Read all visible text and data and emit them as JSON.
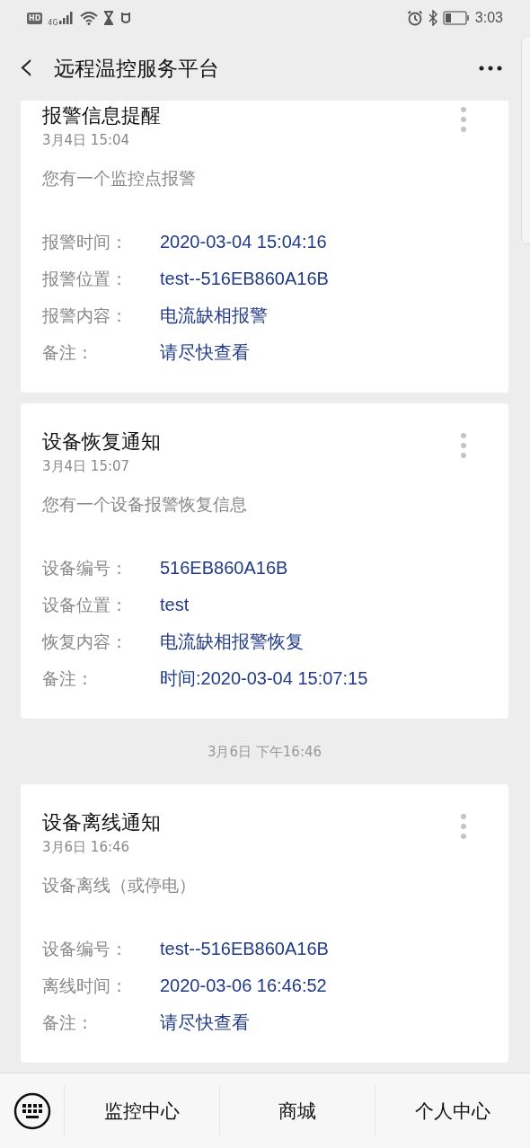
{
  "status_bar": {
    "hd_badge": "HD",
    "network": "4G",
    "time": "3:03"
  },
  "header": {
    "back": "‹",
    "title": "远程温控服务平台"
  },
  "feed": [
    {
      "kind": "card",
      "title": "报警信息提醒",
      "date": "3月4日  15:04",
      "summary": "您有一个监控点报警",
      "fields": [
        {
          "label": "报警时间：",
          "value": "2020-03-04 15:04:16"
        },
        {
          "label": "报警位置：",
          "value": "test--516EB860A16B"
        },
        {
          "label": "报警内容：",
          "value": "电流缺相报警"
        },
        {
          "label": "备注：",
          "value": "请尽快查看"
        }
      ]
    },
    {
      "kind": "card",
      "title": "设备恢复通知",
      "date": "3月4日  15:07",
      "summary": "您有一个设备报警恢复信息",
      "fields": [
        {
          "label": "设备编号：",
          "value": "516EB860A16B"
        },
        {
          "label": "设备位置：",
          "value": "test"
        },
        {
          "label": "恢复内容：",
          "value": "电流缺相报警恢复"
        },
        {
          "label": "备注：",
          "value": "时间:2020-03-04 15:07:15"
        }
      ]
    },
    {
      "kind": "timestamp",
      "text": "3月6日 下午16:46"
    },
    {
      "kind": "card",
      "title": "设备离线通知",
      "date": "3月6日  16:46",
      "summary": "设备离线（或停电）",
      "fields": [
        {
          "label": "设备编号：",
          "value": "test--516EB860A16B"
        },
        {
          "label": "离线时间：",
          "value": "2020-03-06 16:46:52"
        },
        {
          "label": "备注：",
          "value": "请尽快查看"
        }
      ]
    }
  ],
  "bottom_menu": [
    "监控中心",
    "商城",
    "个人中心"
  ]
}
